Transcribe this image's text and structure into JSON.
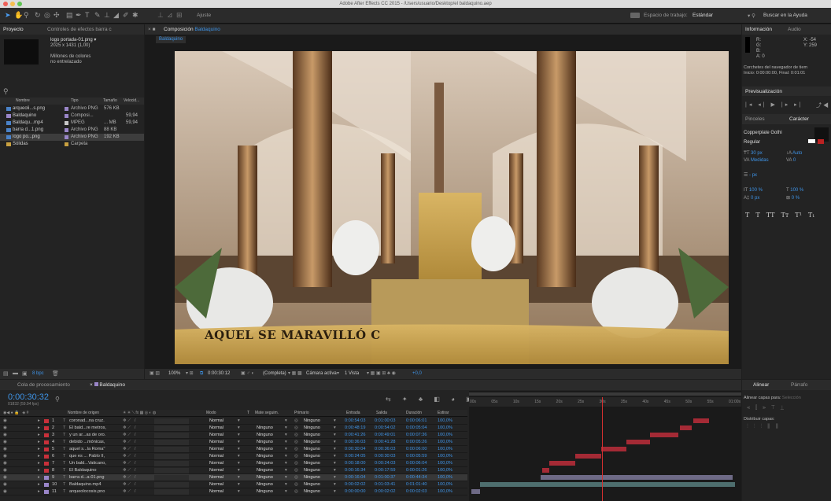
{
  "window": {
    "title": "Adobe After Effects CC 2015 - /Users/usuario/Desktop/el baldaquino.aep"
  },
  "toolbar": {
    "ajuste": "Ajuste",
    "workspace_label": "Espacio de trabajo:",
    "workspace_value": "Estándar",
    "search_placeholder": "Buscar en la Ayuda"
  },
  "project": {
    "tab_project": "Proyecto",
    "tab_effects": "Controles de efectos barra c",
    "item_name": "logo portada-01.png ▾",
    "item_size": "2025 x 1431 (1,00)",
    "item_colors": "Millones de colores",
    "item_interlace": "no entrelazado",
    "columns": [
      "Nombre",
      "Tipo",
      "Tamaño",
      "Velocid..."
    ],
    "items": [
      {
        "name": "arqueoli...s.png",
        "type": "Archivo PNG",
        "size": "576 KB",
        "rate": ""
      },
      {
        "name": "Baldaquino",
        "type": "Composi...",
        "size": "",
        "rate": "59,94"
      },
      {
        "name": "Baldaqu...mp4",
        "type": "MPEG",
        "size": "... MB",
        "rate": "59,94"
      },
      {
        "name": "barra d...1.png",
        "type": "Archivo PNG",
        "size": "88 KB",
        "rate": ""
      },
      {
        "name": "logo po...png",
        "type": "Archivo PNG",
        "size": "192 KB",
        "rate": ""
      },
      {
        "name": "Sólidas",
        "type": "Carpeta",
        "size": "",
        "rate": ""
      }
    ],
    "bpc": "8 bpc"
  },
  "composition": {
    "tab_label": "Composición",
    "comp_name": "Baldaquino",
    "flow_tab": "Baldaquino",
    "lower_third": "AQUEL SE MARAVILLÓ C",
    "zoom": "100%",
    "timecode": "0:00:30:12",
    "resolution": "(Completa)",
    "camera": "Cámara activa",
    "views": "1 Vista",
    "exposure": "+0,0"
  },
  "info": {
    "tab_info": "Información",
    "tab_audio": "Audio",
    "r": "R:",
    "g": "G:",
    "b": "B:",
    "a": "A: 0",
    "x": "X: -54",
    "y": "Y: 259",
    "note1": "Corchetes del navegador de tiem",
    "note2": "Inicio: 0:00:00:00, Final: 0:01:01"
  },
  "preview": {
    "title": "Previsualización"
  },
  "character": {
    "tab_brushes": "Pinceles",
    "tab_char": "Carácter",
    "font": "Copperplate Gothi",
    "style": "Regular",
    "size": "30 px",
    "leading": "Auto",
    "kerning": "Medidas",
    "tracking": "0",
    "stroke": "- px",
    "vscale": "100 %",
    "hscale": "100 %",
    "baseline": "0 px",
    "tsume": "0 %",
    "styles": [
      "T",
      "T",
      "TT",
      "Tт",
      "T¹",
      "T₁"
    ]
  },
  "align": {
    "tab_align": "Alinear",
    "tab_para": "Párrafo",
    "align_to": "Alinear capas para:",
    "align_sel": "Selección",
    "distribute": "Distribuir capas:"
  },
  "timeline": {
    "tab_queue": "Cola de procesamiento",
    "tab_comp": "Baldaquino",
    "timecode": "0:00:30:32",
    "frames": "01832 (59.94 fps)",
    "columns": [
      "Nombre de origen",
      "Modo",
      "T",
      "Mate seguim.",
      "Primario",
      "Entrada",
      "Salida",
      "Duración",
      "Estirar"
    ],
    "ruler": [
      "00s",
      "05s",
      "10s",
      "15s",
      "20s",
      "25s",
      "30s",
      "35s",
      "40s",
      "45s",
      "50s",
      "55s",
      "01:00s"
    ],
    "layers": [
      {
        "num": "1",
        "name": "coronad...na cruz.",
        "mode": "Normal",
        "matte": "",
        "parent": "Ninguno",
        "in": "0:00:54:03",
        "out": "0:01:00:03",
        "dur": "0:00:06:01",
        "stretch": "100,0%",
        "color": "#c8303a",
        "bar_start": 51.5,
        "bar_end": 55,
        "bar_color": "#a42a35"
      },
      {
        "num": "2",
        "name": "El bald...re metros,",
        "mode": "Normal",
        "matte": "Ninguno",
        "parent": "Ninguno",
        "in": "0:00:48:19",
        "out": "0:00:54:02",
        "dur": "0:00:05:04",
        "stretch": "100,0%",
        "color": "#c8303a",
        "bar_start": 48.3,
        "bar_end": 51,
        "bar_color": "#a42a35"
      },
      {
        "num": "3",
        "name": "y un ar...as de oro.",
        "mode": "Normal",
        "matte": "Ninguno",
        "parent": "Ninguno",
        "in": "0:00:41:26",
        "out": "0:00:49:01",
        "dur": "0:00:07:36",
        "stretch": "100,0%",
        "color": "#c8303a",
        "bar_start": 41.4,
        "bar_end": 48,
        "bar_color": "#a42a35"
      },
      {
        "num": "4",
        "name": "debido ...mónicas,",
        "mode": "Normal",
        "matte": "Ninguno",
        "parent": "Ninguno",
        "in": "0:00:36:03",
        "out": "0:00:41:28",
        "dur": "0:00:05:26",
        "stretch": "100,0%",
        "color": "#c8303a",
        "bar_start": 36,
        "bar_end": 41.4,
        "bar_color": "#a42a35"
      },
      {
        "num": "5",
        "name": "aquel s...la Roma\"",
        "mode": "Normal",
        "matte": "Ninguno",
        "parent": "Ninguno",
        "in": "0:00:30:04",
        "out": "0:00:36:03",
        "dur": "0:00:06:00",
        "stretch": "100,0%",
        "color": "#c8303a",
        "bar_start": 30,
        "bar_end": 36,
        "bar_color": "#a42a35"
      },
      {
        "num": "6",
        "name": "que es ... Pablo II,",
        "mode": "Normal",
        "matte": "Ninguno",
        "parent": "Ninguno",
        "in": "0:00:24:05",
        "out": "0:00:30:03",
        "dur": "0:00:05:59",
        "stretch": "100,0%",
        "color": "#c8303a",
        "bar_start": 24,
        "bar_end": 30,
        "bar_color": "#a42a35"
      },
      {
        "num": "7",
        "name": "Un bald...Vaticano,",
        "mode": "Normal",
        "matte": "Ninguno",
        "parent": "Ninguno",
        "in": "0:00:18:00",
        "out": "0:00:24:03",
        "dur": "0:00:06:04",
        "stretch": "100,0%",
        "color": "#c8303a",
        "bar_start": 18,
        "bar_end": 24,
        "bar_color": "#a42a35"
      },
      {
        "num": "8",
        "name": "El Baldaquino",
        "mode": "Normal",
        "matte": "Ninguno",
        "parent": "Ninguno",
        "in": "0:00:16:34",
        "out": "0:00:17:59",
        "dur": "0:00:01:26",
        "stretch": "100,0%",
        "color": "#c8303a",
        "bar_start": 16.5,
        "bar_end": 18,
        "bar_color": "#a42a35"
      },
      {
        "num": "9",
        "name": "barra d...a-01.png",
        "mode": "Normal",
        "matte": "Ninguno",
        "parent": "Ninguno",
        "in": "0:00:16:04",
        "out": "0:01:00:37",
        "dur": "0:00:44:34",
        "stretch": "100,0%",
        "color": "#9a86c8",
        "bar_start": 16,
        "bar_end": 60.5,
        "bar_color": "#6e6a86"
      },
      {
        "num": "10",
        "name": "Baldaquino.mp4",
        "mode": "Normal",
        "matte": "Ninguno",
        "parent": "Ninguno",
        "in": "0:00:02:02",
        "out": "0:01:03:41",
        "dur": "0:01:01:40",
        "stretch": "100,0%",
        "color": "#9a86c8",
        "bar_start": 2,
        "bar_end": 61,
        "bar_color": "#4e6e6e"
      },
      {
        "num": "11",
        "name": "arqueolocosis.pno",
        "mode": "Normal",
        "matte": "Ninguno",
        "parent": "Ninguno",
        "in": "0:00:00:00",
        "out": "0:00:02:02",
        "dur": "0:00:02:03",
        "stretch": "100,0%",
        "color": "#9a86c8",
        "bar_start": 0,
        "bar_end": 2,
        "bar_color": "#6e6a86"
      }
    ]
  }
}
